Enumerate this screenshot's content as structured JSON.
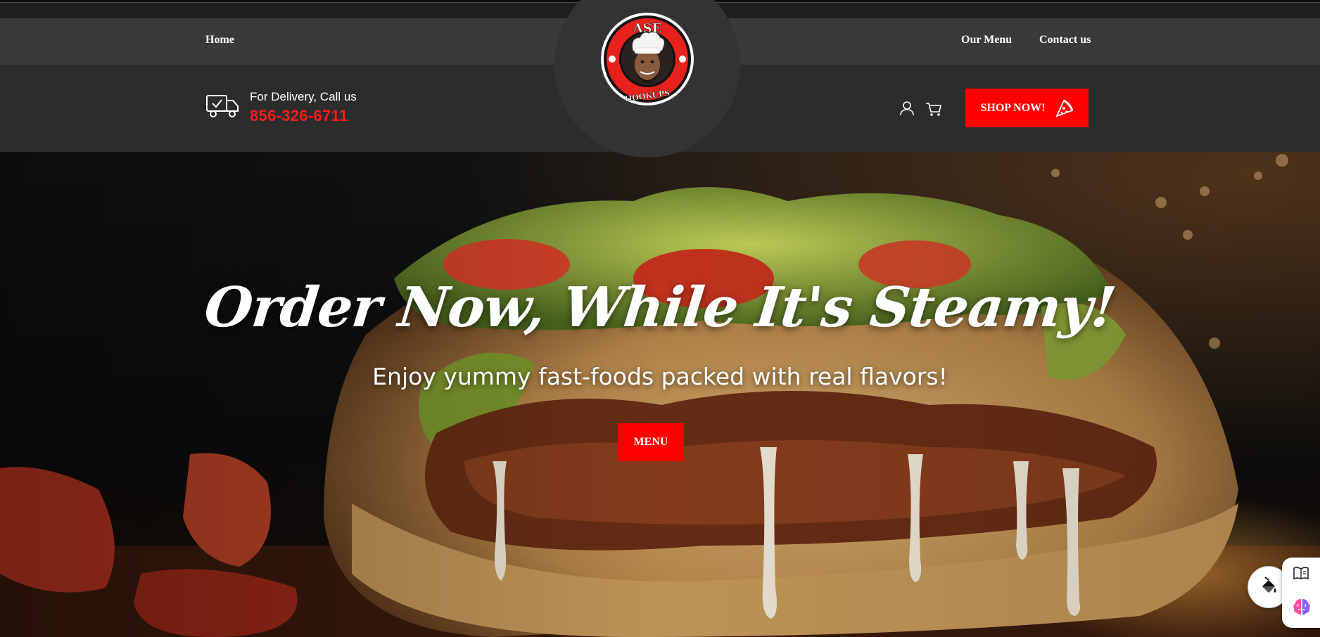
{
  "nav": {
    "home": "Home",
    "our_menu": "Our Menu",
    "contact": "Contact us"
  },
  "logo": {
    "top_text": "ASE",
    "bottom_text": "HOOKUPS"
  },
  "delivery": {
    "label": "For Delivery, Call us",
    "phone": "856-326-6711"
  },
  "header_actions": {
    "shop_label": "SHOP NOW!",
    "user_icon": "user-icon",
    "cart_icon": "cart-icon",
    "shop_icon": "pizza-slice-icon"
  },
  "hero": {
    "title": "Order Now, While It's Steamy!",
    "subtitle": "Enjoy yummy fast-foods packed with real flavors!",
    "button_label": "MENU"
  },
  "floating_tools": {
    "paint_icon": "paint-bucket-icon",
    "reader_icon": "reader-mode-icon",
    "assistant_icon": "brain-icon"
  },
  "colors": {
    "accent": "#ff0000",
    "phone": "#ff1a1a",
    "nav_bg": "#3a3a3a",
    "header_bg": "#2c2c2c",
    "text": "#ffffff"
  }
}
